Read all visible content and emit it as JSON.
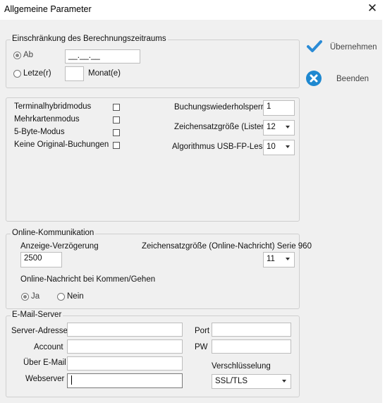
{
  "window": {
    "title": "Allgemeine Parameter"
  },
  "actions": {
    "apply": "Übernehmen",
    "exit": "Beenden"
  },
  "berechnung": {
    "legend": "Einschränkung des Berechnungszeitraums",
    "ab_label": "Ab",
    "date_value": "__.__.__",
    "letzte_label": "Letze(r)",
    "monat_label": "Monat(e)"
  },
  "optionen": {
    "checks": [
      "Terminalhybridmodus",
      "Mehrkartenmodus",
      "5-Byte-Modus",
      "Keine Original-Buchungen"
    ],
    "sperre_label": "Buchungswiederholsperre",
    "sperre_value": "1",
    "zeichensatz_label": "Zeichensatzgröße (Listen)",
    "zeichensatz_value": "12",
    "algorithmus_label": "Algorithmus USB-FP-Leser",
    "algorithmus_value": "10"
  },
  "online": {
    "legend": "Online-Kommunikation",
    "delay_label": "Anzeige-Verzögerung",
    "delay_value": "2500",
    "font_label": "Zeichensatzgröße (Online-Nachricht) Serie 960",
    "font_value": "11",
    "msg_label": "Online-Nachricht bei Kommen/Gehen",
    "ja": "Ja",
    "nein": "Nein"
  },
  "email": {
    "legend": "E-Mail-Server",
    "server_label": "Server-Adresse",
    "account_label": "Account",
    "ueber_label": "Über E-Mail",
    "webserver_label": "Webserver",
    "port_label": "Port",
    "pw_label": "PW",
    "verschluesselung_label": "Verschlüsselung",
    "verschluesselung_value": "SSL/TLS"
  }
}
